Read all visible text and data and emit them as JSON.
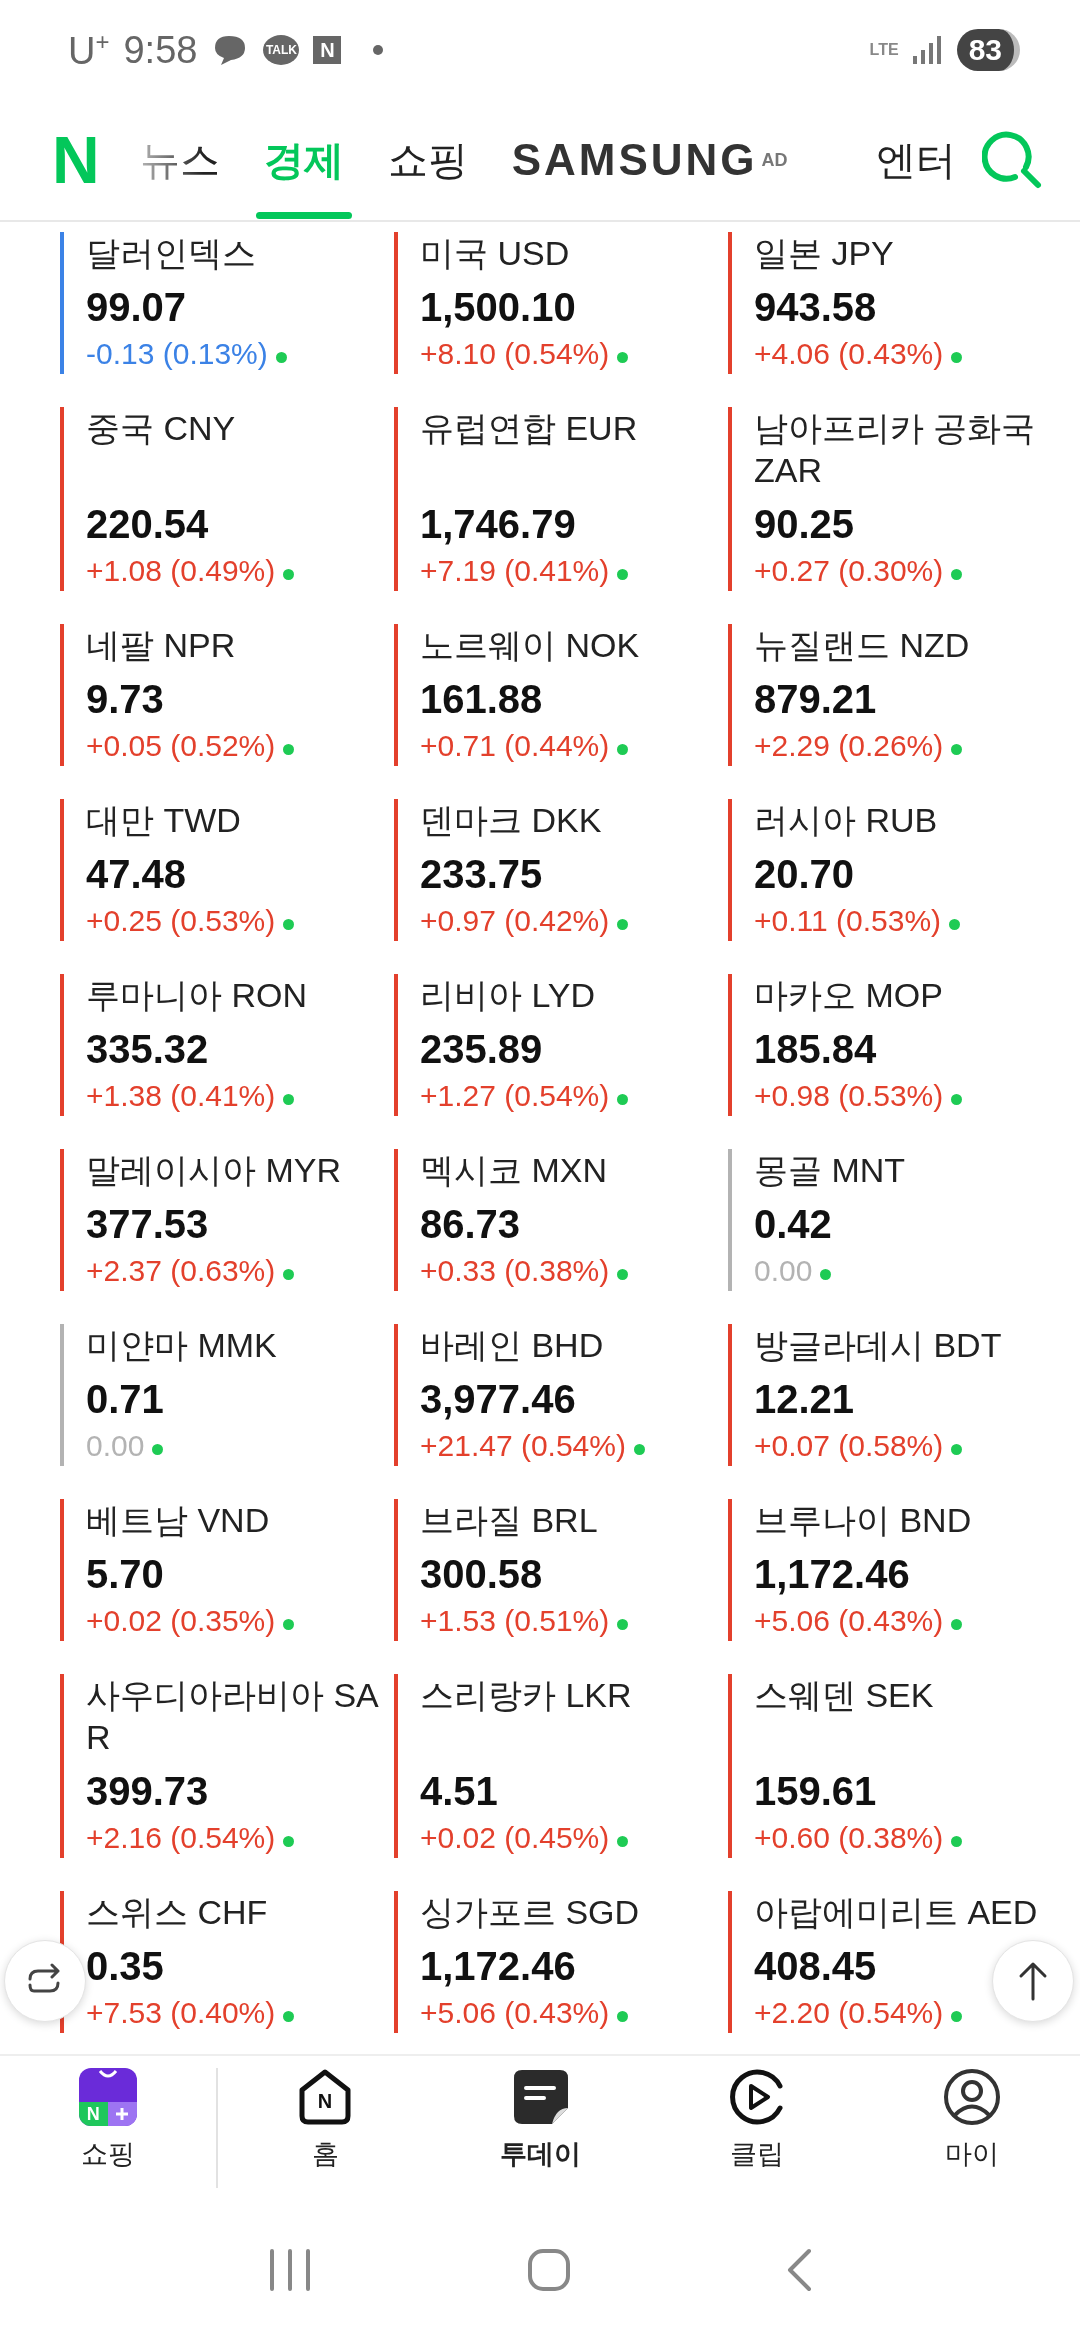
{
  "status_bar": {
    "carrier": "U$^{+}$",
    "time": "9:58",
    "talk_badge": "TALK",
    "app_badge": "N",
    "network": "LTE",
    "battery": "83"
  },
  "header": {
    "logo": "N",
    "tabs": [
      {
        "label": "뉴스",
        "selected": false,
        "faded": true,
        "kind": "text"
      },
      {
        "label": "경제",
        "selected": true,
        "faded": false,
        "kind": "text"
      },
      {
        "label": "쇼핑",
        "selected": false,
        "faded": false,
        "kind": "text"
      },
      {
        "label": "SAMSUNG",
        "badge": "AD",
        "selected": false,
        "faded": false,
        "kind": "brand"
      },
      {
        "label": "엔터",
        "selected": false,
        "faded": false,
        "kind": "text"
      }
    ]
  },
  "rates": [
    {
      "name": "달러인덱스",
      "value": "99.07",
      "change": "-0.13 (0.13%)",
      "kind": "down"
    },
    {
      "name": "미국 USD",
      "value": "1,500.10",
      "change": "+8.10 (0.54%)",
      "kind": "up"
    },
    {
      "name": "일본 JPY",
      "value": "943.58",
      "change": "+4.06 (0.43%)",
      "kind": "up"
    },
    {
      "name": "중국 CNY",
      "value": "220.54",
      "change": "+1.08 (0.49%)",
      "kind": "up"
    },
    {
      "name": "유럽연합 EUR",
      "value": "1,746.79",
      "change": "+7.19 (0.41%)",
      "kind": "up"
    },
    {
      "name": "남아프리카 공화국 ZAR",
      "value": "90.25",
      "change": "+0.27 (0.30%)",
      "kind": "up"
    },
    {
      "name": "네팔 NPR",
      "value": "9.73",
      "change": "+0.05 (0.52%)",
      "kind": "up"
    },
    {
      "name": "노르웨이 NOK",
      "value": "161.88",
      "change": "+0.71 (0.44%)",
      "kind": "up"
    },
    {
      "name": "뉴질랜드 NZD",
      "value": "879.21",
      "change": "+2.29 (0.26%)",
      "kind": "up"
    },
    {
      "name": "대만 TWD",
      "value": "47.48",
      "change": "+0.25 (0.53%)",
      "kind": "up"
    },
    {
      "name": "덴마크 DKK",
      "value": "233.75",
      "change": "+0.97 (0.42%)",
      "kind": "up"
    },
    {
      "name": "러시아 RUB",
      "value": "20.70",
      "change": "+0.11 (0.53%)",
      "kind": "up"
    },
    {
      "name": "루마니아 RON",
      "value": "335.32",
      "change": "+1.38 (0.41%)",
      "kind": "up"
    },
    {
      "name": "리비아 LYD",
      "value": "235.89",
      "change": "+1.27 (0.54%)",
      "kind": "up"
    },
    {
      "name": "마카오 MOP",
      "value": "185.84",
      "change": "+0.98 (0.53%)",
      "kind": "up"
    },
    {
      "name": "말레이시아 MYR",
      "value": "377.53",
      "change": "+2.37 (0.63%)",
      "kind": "up"
    },
    {
      "name": "멕시코 MXN",
      "value": "86.73",
      "change": "+0.33 (0.38%)",
      "kind": "up"
    },
    {
      "name": "몽골 MNT",
      "value": "0.42",
      "change": "0.00",
      "kind": "flat"
    },
    {
      "name": "미얀마 MMK",
      "value": "0.71",
      "change": "0.00",
      "kind": "flat"
    },
    {
      "name": "바레인 BHD",
      "value": "3,977.46",
      "change": "+21.47 (0.54%)",
      "kind": "up"
    },
    {
      "name": "방글라데시 BDT",
      "value": "12.21",
      "change": "+0.07 (0.58%)",
      "kind": "up"
    },
    {
      "name": "베트남 VND",
      "value": "5.70",
      "change": "+0.02 (0.35%)",
      "kind": "up"
    },
    {
      "name": "브라질 BRL",
      "value": "300.58",
      "change": "+1.53 (0.51%)",
      "kind": "up"
    },
    {
      "name": "브루나이 BND",
      "value": "1,172.46",
      "change": "+5.06 (0.43%)",
      "kind": "up"
    },
    {
      "name": "사우디아라비아 SAR",
      "value": "399.73",
      "change": "+2.16 (0.54%)",
      "kind": "up"
    },
    {
      "name": "스리랑카 LKR",
      "value": "4.51",
      "change": "+0.02 (0.45%)",
      "kind": "up"
    },
    {
      "name": "스웨덴 SEK",
      "value": "159.61",
      "change": "+0.60 (0.38%)",
      "kind": "up"
    },
    {
      "name": "스위스 CHF",
      "value": "0.35",
      "change": "+7.53 (0.40%)",
      "kind": "up"
    },
    {
      "name": "싱가포르 SGD",
      "value": "1,172.46",
      "change": "+5.06 (0.43%)",
      "kind": "up"
    },
    {
      "name": "아랍에미리트 AED",
      "value": "408.45",
      "change": "+2.20 (0.54%)",
      "kind": "up"
    }
  ],
  "bottom_nav": [
    {
      "label": "쇼핑",
      "icon_label": "N",
      "selected": false
    },
    {
      "label": "홈",
      "icon_label": "N",
      "selected": false
    },
    {
      "label": "투데이",
      "selected": true
    },
    {
      "label": "클립",
      "selected": false
    },
    {
      "label": "마이",
      "selected": false
    }
  ]
}
